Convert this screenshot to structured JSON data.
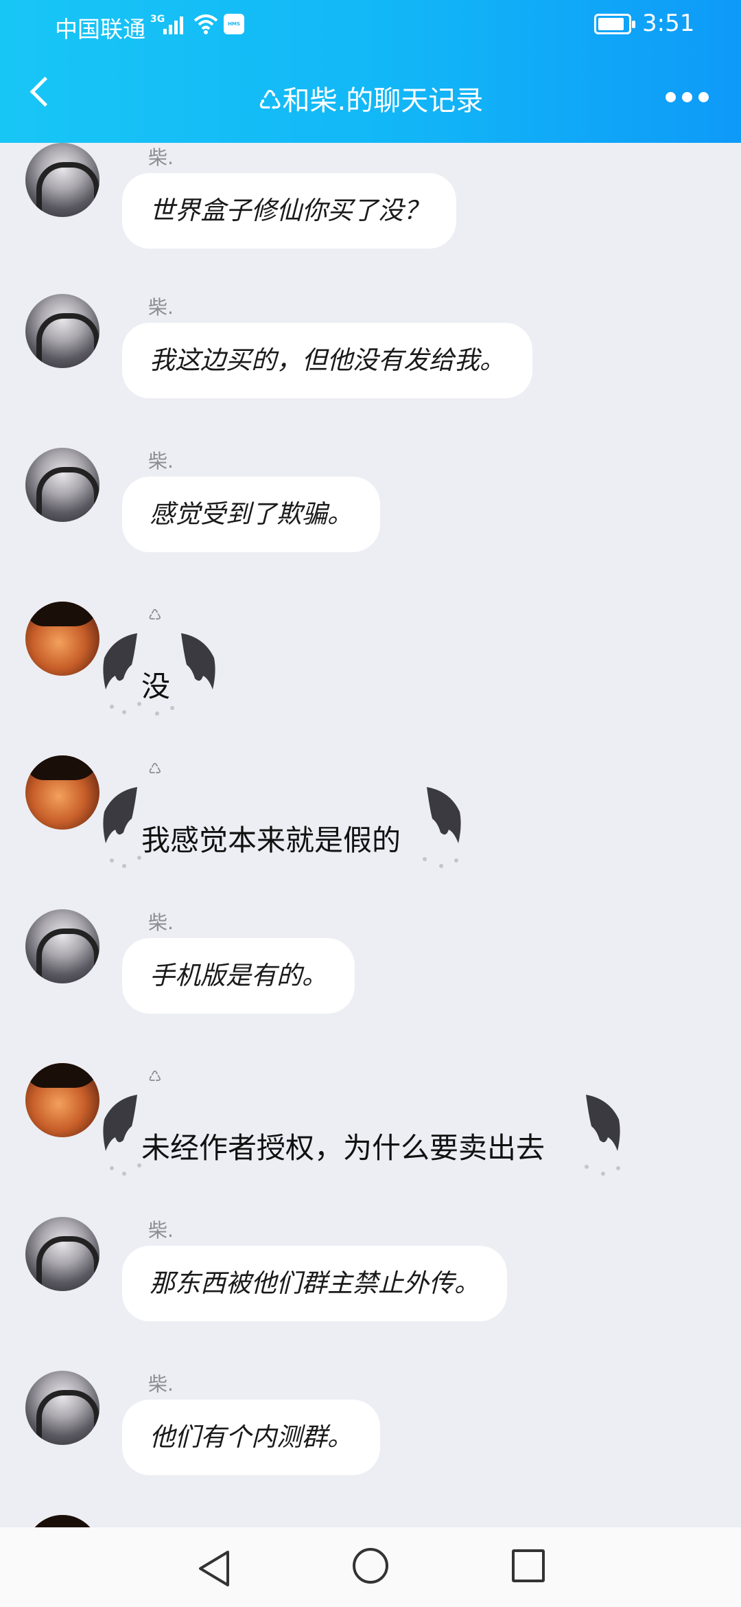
{
  "status_bar": {
    "carrier": "中国联通",
    "network": "3G",
    "hms_label": "HMS",
    "time": "3:51"
  },
  "header": {
    "title": "♺和柴.的聊天记录"
  },
  "messages": [
    {
      "sender": "柴.",
      "text": "世界盒子修仙你买了没？",
      "side": "chai"
    },
    {
      "sender": "柴.",
      "text": "我这边买的，但他没有发给我。",
      "side": "chai"
    },
    {
      "sender": "柴.",
      "text": "感觉受到了欺骗。",
      "side": "chai"
    },
    {
      "sender": "♺",
      "text": "没",
      "side": "other"
    },
    {
      "sender": "♺",
      "text": "我感觉本来就是假的",
      "side": "other"
    },
    {
      "sender": "柴.",
      "text": "手机版是有的。",
      "side": "chai"
    },
    {
      "sender": "♺",
      "text": "未经作者授权，为什么要卖出去",
      "side": "other"
    },
    {
      "sender": "柴.",
      "text": "那东西被他们群主禁止外传。",
      "side": "chai"
    },
    {
      "sender": "柴.",
      "text": "他们有个内测群。",
      "side": "chai"
    }
  ],
  "icons": {
    "back": "chevron-left-icon",
    "more": "more-dots-icon",
    "nav_back": "triangle-back-icon",
    "nav_home": "circle-home-icon",
    "nav_recent": "square-recent-icon"
  },
  "colors": {
    "header_start": "#18c6f6",
    "header_end": "#0e9af8",
    "chat_background": "#eceef3",
    "bubble": "#ffffff"
  }
}
